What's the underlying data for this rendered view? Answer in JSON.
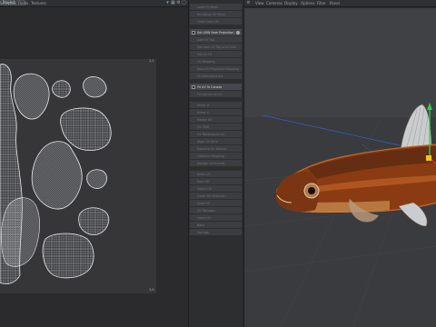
{
  "menubar": {
    "items": [
      "Selection",
      "Fields",
      "Textures"
    ],
    "project_dropdown": "Project"
  },
  "uv_editor": {
    "corner_top_right": "1,1",
    "corner_bottom_right": "1,0"
  },
  "commands": [
    {
      "label": "Load UV Mesh",
      "active": false
    },
    {
      "label": "Re-adjust UV Mesh",
      "active": false
    },
    {
      "label": "Load Cubic UV",
      "active": false
    },
    {
      "label": "Set UVW from Projection",
      "active": true,
      "checkbox": true,
      "icon": true
    },
    {
      "label": "Add UV Tag",
      "active": false
    },
    {
      "label": "Set from UV Tag and Cube",
      "active": false
    },
    {
      "label": "Set UV Fit",
      "active": false
    },
    {
      "label": "UV Mapping",
      "active": false
    },
    {
      "label": "Auto UV Projection Mapping",
      "active": false
    },
    {
      "label": "Fit Selection/Lock",
      "active": false
    },
    {
      "label": "Fit UV To Canvas",
      "active": true,
      "checkbox": true
    },
    {
      "label": "Fit Canvas to UV",
      "active": false
    },
    {
      "label": "Mirror U",
      "active": false
    },
    {
      "label": "Mirror V",
      "active": false
    },
    {
      "label": "Rotate UV",
      "active": false
    },
    {
      "label": "UV Shift",
      "active": false
    },
    {
      "label": "UV Rectangularize",
      "active": false
    },
    {
      "label": "Align UV Strip",
      "active": false
    },
    {
      "label": "Equalize UV Islands",
      "active": false
    },
    {
      "label": "Optimize Mapping",
      "active": false
    },
    {
      "label": "Realign UV Islands",
      "active": false
    },
    {
      "label": "Relax UV",
      "active": false
    },
    {
      "label": "Pack UV",
      "active": false
    },
    {
      "label": "Select UV",
      "active": false
    },
    {
      "label": "Invert UV Selection",
      "active": false
    },
    {
      "label": "Snap UV",
      "active": false
    },
    {
      "label": "UV Manager",
      "active": false
    },
    {
      "label": "Layer UV",
      "active": false
    },
    {
      "label": "Bake",
      "active": false
    },
    {
      "label": "Storage",
      "active": false
    }
  ],
  "viewport": {
    "menu": [
      "View",
      "Cameras",
      "Display",
      "Options",
      "Filter",
      "Panel"
    ],
    "view_name": "Perspective",
    "camera": "Default Camera",
    "move_label": "Move",
    "status": "View Transform: Scene"
  },
  "colors": {
    "uv_wire": "#d9dbdf",
    "fish_body": "#8a3b12",
    "fish_fin": "#c9ccd0",
    "gizmo_green": "#2bd14a",
    "gizmo_blue": "#2f6cf0"
  }
}
